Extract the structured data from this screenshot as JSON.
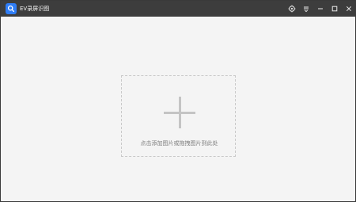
{
  "window": {
    "title": "EV录屏识图",
    "colors": {
      "titlebar": "#3d3d3d",
      "content": "#f4f4f4",
      "accent": "#2f7df6",
      "dropzone_border": "#c9c9c9",
      "plus": "#c4c4c4",
      "hint_text": "#7d7d7d"
    }
  },
  "titlebar": {
    "app_icon": "search-icon",
    "controls": [
      "settings-icon",
      "menu-icon",
      "minimize-icon",
      "maximize-icon",
      "close-icon"
    ]
  },
  "main": {
    "dropzone": {
      "icon": "plus-icon",
      "hint": "点击添加图片或拖拽图片到此处"
    }
  }
}
